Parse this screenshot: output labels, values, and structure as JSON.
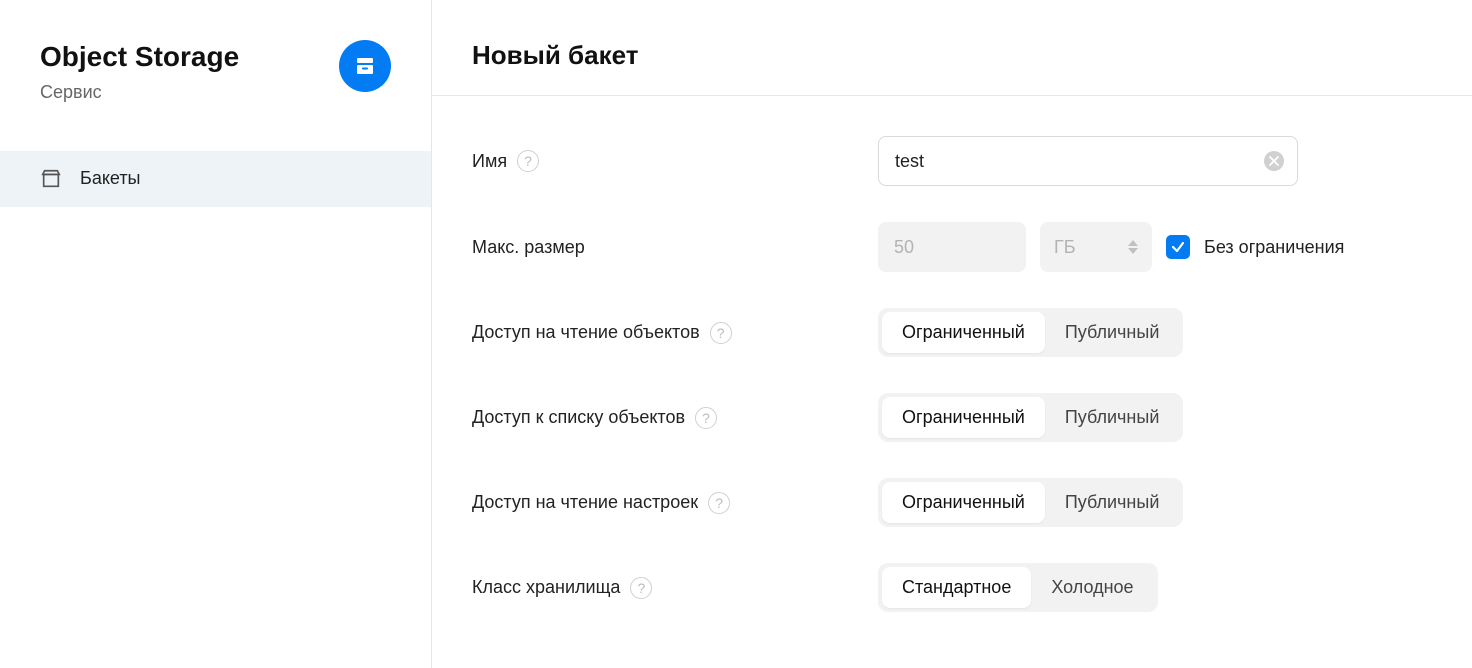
{
  "sidebar": {
    "title": "Object Storage",
    "subtitle": "Сервис",
    "nav": [
      {
        "label": "Бакеты",
        "active": true
      }
    ]
  },
  "main": {
    "heading": "Новый бакет",
    "form": {
      "name": {
        "label": "Имя",
        "value": "test"
      },
      "max_size": {
        "label": "Макс. размер",
        "value": "50",
        "unit": "ГБ",
        "unlimited_checked": true,
        "unlimited_label": "Без ограничения"
      },
      "read_objects": {
        "label": "Доступ на чтение объектов",
        "options": [
          "Ограниченный",
          "Публичный"
        ],
        "selected": 0
      },
      "list_objects": {
        "label": "Доступ к списку объектов",
        "options": [
          "Ограниченный",
          "Публичный"
        ],
        "selected": 0
      },
      "read_settings": {
        "label": "Доступ на чтение настроек",
        "options": [
          "Ограниченный",
          "Публичный"
        ],
        "selected": 0
      },
      "storage_class": {
        "label": "Класс хранилища",
        "options": [
          "Стандартное",
          "Холодное"
        ],
        "selected": 0
      }
    }
  }
}
